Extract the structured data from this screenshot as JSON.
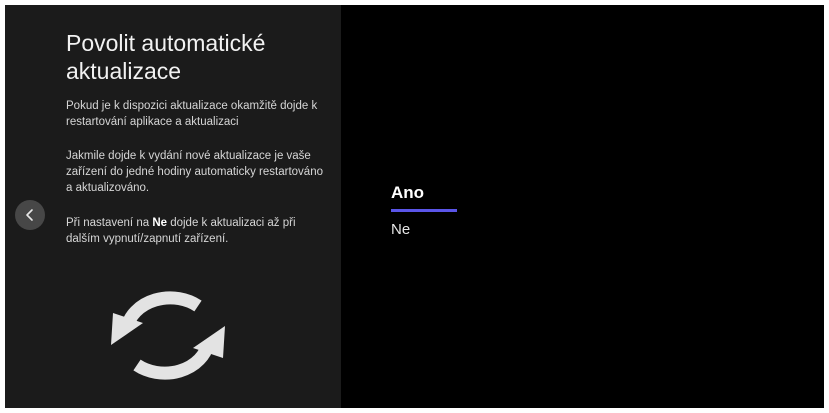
{
  "settings": {
    "title": "Povolit automatické aktualizace",
    "paragraph1": "Pokud je k dispozici aktualizace okamžitě dojde k restartování aplikace a aktualizaci",
    "paragraph2": "Jakmile dojde k vydání nové aktualizace je vaše zařízení do jedné hodiny automaticky restartováno a aktualizováno.",
    "paragraph3_before": "Při nastavení na ",
    "paragraph3_bold": "Ne",
    "paragraph3_after": " dojde k aktualizaci až při dalším vypnutí/zapnutí zařízení."
  },
  "options": {
    "yes_label": "Ano",
    "no_label": "Ne",
    "selected": "Ano",
    "accent_color": "#5a55e8"
  },
  "icons": {
    "back": "chevron-left-icon",
    "illustration": "refresh-icon"
  }
}
